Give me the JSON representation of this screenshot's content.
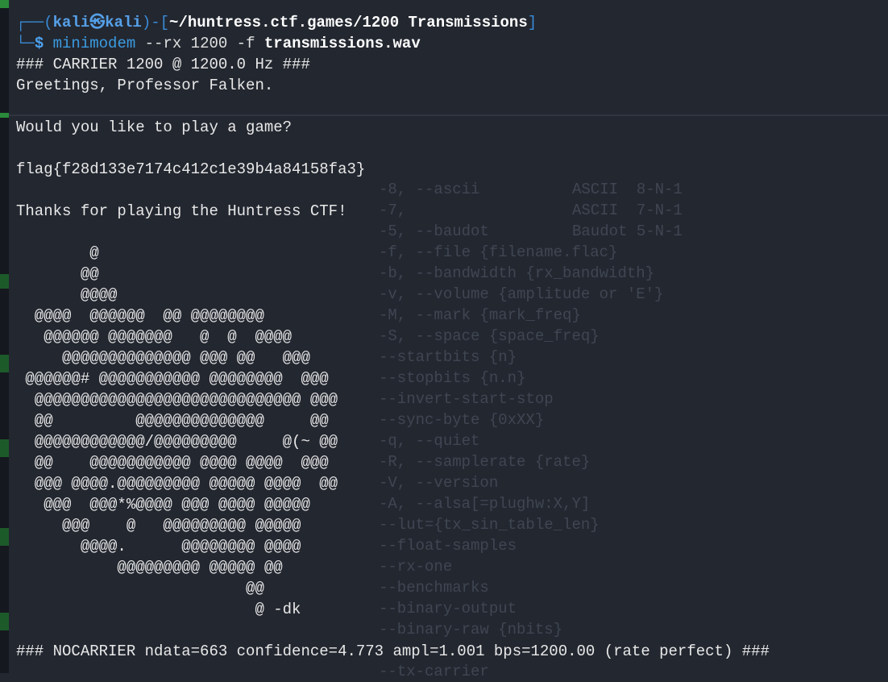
{
  "prompt": {
    "frame_top": "┌──(",
    "user": "kali㉿kali",
    "frame_mid": ")-[",
    "path": "~/huntress.ctf.games/1200 Transmissions",
    "frame_end": "]",
    "frame_bottom": "└─",
    "dollar": "$",
    "command": "minimodem",
    "args": " --rx 1200 -f ",
    "file": "transmissions.wav"
  },
  "output": [
    "### CARRIER 1200 @ 1200.0 Hz ###",
    "Greetings, Professor Falken.",
    "",
    "Would you like to play a game?",
    "",
    "flag{f28d133e7174c412c1e39b4a84158fa3}",
    "",
    "Thanks for playing the Huntress CTF!",
    ""
  ],
  "ascii_art": [
    "        @",
    "       @@",
    "       @@@@",
    "  @@@@  @@@@@@  @@ @@@@@@@@",
    "   @@@@@@ @@@@@@@   @  @  @@@@",
    "     @@@@@@@@@@@@@@ @@@ @@   @@@",
    " @@@@@@# @@@@@@@@@@@ @@@@@@@@  @@@",
    "  @@@@@@@@@@@@@@@@@@@@@@@@@@@@@ @@@",
    "  @@         @@@@@@@@@@@@@@     @@",
    "  @@@@@@@@@@@@/@@@@@@@@@     @(~ @@",
    "  @@    @@@@@@@@@@@ @@@@ @@@@  @@@",
    "  @@@ @@@@.@@@@@@@@@ @@@@@ @@@@  @@",
    "   @@@  @@@*%@@@@ @@@ @@@@ @@@@@",
    "     @@@    @   @@@@@@@@@ @@@@@",
    "       @@@@.      @@@@@@@@ @@@@",
    "           @@@@@@@@@ @@@@@ @@",
    "                         @@",
    "                          @ -dk"
  ],
  "nocarrier": "### NOCARRIER ndata=663 confidence=4.773 ampl=1.001 bps=1200.00 (rate perfect) ###",
  "background_help": [
    [
      "-8, --ascii",
      "ASCII  8-N-1"
    ],
    [
      "-7,",
      "ASCII  7-N-1"
    ],
    [
      "-5, --baudot",
      "Baudot 5-N-1"
    ],
    [
      "-f, --file {filename.flac}",
      ""
    ],
    [
      "-b, --bandwidth {rx_bandwidth}",
      ""
    ],
    [
      "-v, --volume {amplitude or 'E'}",
      ""
    ],
    [
      "-M, --mark {mark_freq}",
      ""
    ],
    [
      "-S, --space {space_freq}",
      ""
    ],
    [
      "--startbits {n}",
      ""
    ],
    [
      "--stopbits {n.n}",
      ""
    ],
    [
      "--invert-start-stop",
      ""
    ],
    [
      "--sync-byte {0xXX}",
      ""
    ],
    [
      "-q, --quiet",
      ""
    ],
    [
      "-R, --samplerate {rate}",
      ""
    ],
    [
      "-V, --version",
      ""
    ],
    [
      "-A, --alsa[=plughw:X,Y]",
      ""
    ],
    [
      "--lut={tx_sin_table_len}",
      ""
    ],
    [
      "--float-samples",
      ""
    ],
    [
      "--rx-one",
      ""
    ],
    [
      "--benchmarks",
      ""
    ],
    [
      "--binary-output",
      ""
    ],
    [
      "--binary-raw {nbits}",
      ""
    ],
    [
      "",
      ""
    ],
    [
      "--tx-carrier",
      ""
    ]
  ],
  "colors": {
    "background": "#232730",
    "prompt_frame": "#3a8bd6",
    "text": "#e8e8e8",
    "ghost_text": "#3f4652"
  }
}
